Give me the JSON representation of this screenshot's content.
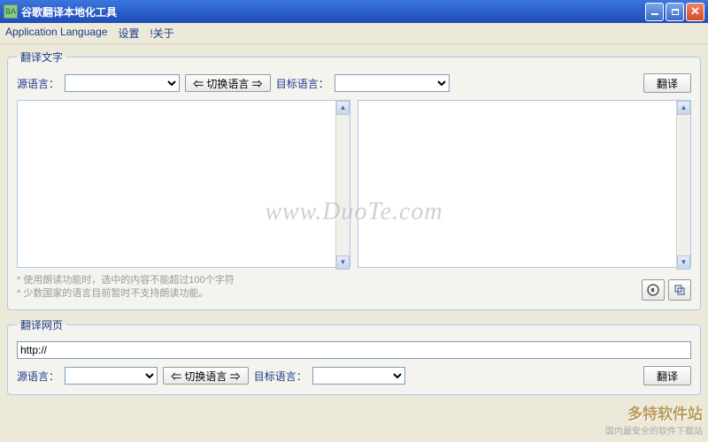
{
  "window": {
    "title": "谷歌翻译本地化工具"
  },
  "menu": {
    "app_lang": "Application Language",
    "settings": "设置",
    "about": "!关于"
  },
  "text_panel": {
    "legend": "翻译文字",
    "source_label": "源语言：",
    "swap_label": "⇐ 切换语言 ⇒",
    "target_label": "目标语言：",
    "translate_btn": "翻译",
    "hint1": "* 使用朗读功能时，选中的内容不能超过100个字符",
    "hint2": "* 少数国家的语言目前暂时不支持朗读功能。"
  },
  "web_panel": {
    "legend": "翻译网页",
    "url_value": "http://",
    "source_label": "源语言：",
    "swap_label": "⇐ 切换语言 ⇒",
    "target_label": "目标语言：",
    "translate_btn": "翻译"
  },
  "watermark": {
    "main": "www.DuoTe.com",
    "brand": "多特软件站",
    "brand_sub": "国内最安全的软件下载站"
  }
}
